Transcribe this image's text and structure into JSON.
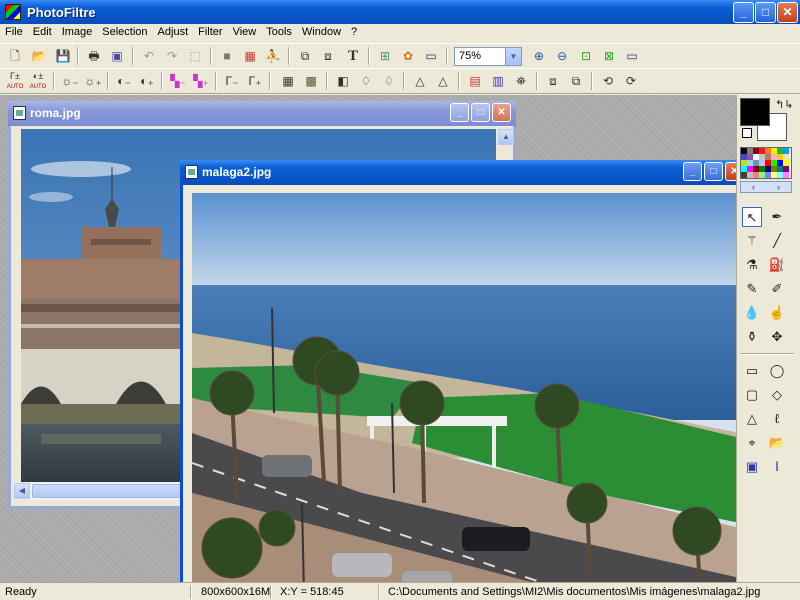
{
  "window": {
    "title": "PhotoFiltre",
    "min_label": "_",
    "max_label": "□",
    "close_label": "✕"
  },
  "menu": [
    "File",
    "Edit",
    "Image",
    "Selection",
    "Adjust",
    "Filter",
    "View",
    "Tools",
    "Window",
    "?"
  ],
  "toolbar": {
    "zoom_value": "75%",
    "text_tool_glyph": "T"
  },
  "toolbar2": {
    "auto_label": "AUTO"
  },
  "documents": {
    "roma": {
      "title": "roma.jpg"
    },
    "malaga": {
      "title": "malaga2.jpg"
    }
  },
  "status": {
    "state": "Ready",
    "dimensions": "800x600x16M",
    "coords": "X:Y = 518:45",
    "path": "C:\\Documents and Settings\\MI2\\Mis documentos\\Mis imágenes\\malaga2.jpg"
  },
  "colors": {
    "foreground": "#000000",
    "background": "#ffffff",
    "palette": [
      "#000000",
      "#7f7f7f",
      "#880015",
      "#ed1c24",
      "#ff7f27",
      "#fff200",
      "#22b14c",
      "#00a2e8",
      "#3f48cc",
      "#a349a4",
      "#ffffff",
      "#c3c3c3",
      "#b97a57",
      "#ffaec9",
      "#ffc90e",
      "#efe4b0",
      "#b5e61d",
      "#99d9ea",
      "#7092be",
      "#c8bfe7",
      "#ff0000",
      "#00ff00",
      "#0000ff",
      "#ffff00",
      "#00ffff",
      "#ff00ff",
      "#800000",
      "#008000",
      "#000080",
      "#808000",
      "#008080",
      "#800080",
      "#404040",
      "#c0c0c0",
      "#ff8080",
      "#80ff80",
      "#8080ff",
      "#ffff80",
      "#80ffff",
      "#ff80ff"
    ]
  }
}
